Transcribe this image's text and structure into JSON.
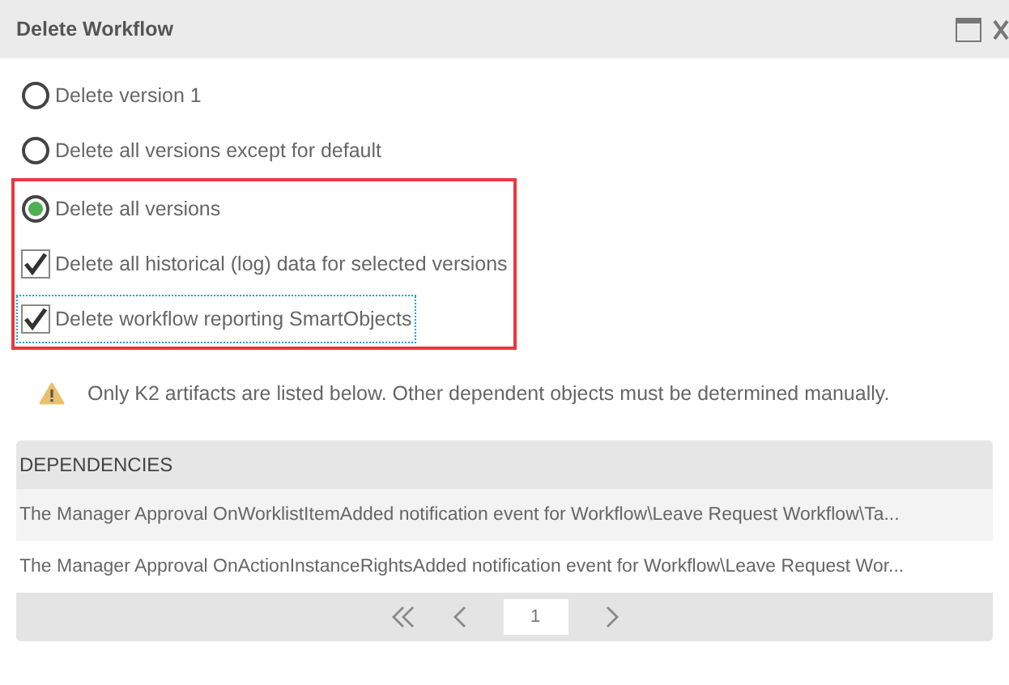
{
  "window": {
    "title": "Delete Workflow"
  },
  "options": [
    {
      "kind": "radio",
      "label": "Delete version 1",
      "selected": false,
      "highlighted": false,
      "focused": false
    },
    {
      "kind": "radio",
      "label": "Delete all versions except for default",
      "selected": false,
      "highlighted": false,
      "focused": false
    },
    {
      "kind": "radio",
      "label": "Delete all versions",
      "selected": true,
      "highlighted": true,
      "focused": false
    },
    {
      "kind": "checkbox",
      "label": "Delete all historical (log) data for selected versions",
      "checked": true,
      "highlighted": true,
      "focused": false
    },
    {
      "kind": "checkbox",
      "label": "Delete workflow reporting SmartObjects",
      "checked": true,
      "highlighted": true,
      "focused": true
    }
  ],
  "warning": "Only K2 artifacts are listed below. Other dependent objects must be determined manually.",
  "table": {
    "columns": [
      "DEPENDENCIES"
    ],
    "rows": [
      "The Manager Approval OnWorklistItemAdded notification event for Workflow\\Leave Request Workflow\\Ta...",
      "The Manager Approval OnActionInstanceRightsAdded notification event for Workflow\\Leave Request Wor..."
    ]
  },
  "pager": {
    "page": "1"
  }
}
